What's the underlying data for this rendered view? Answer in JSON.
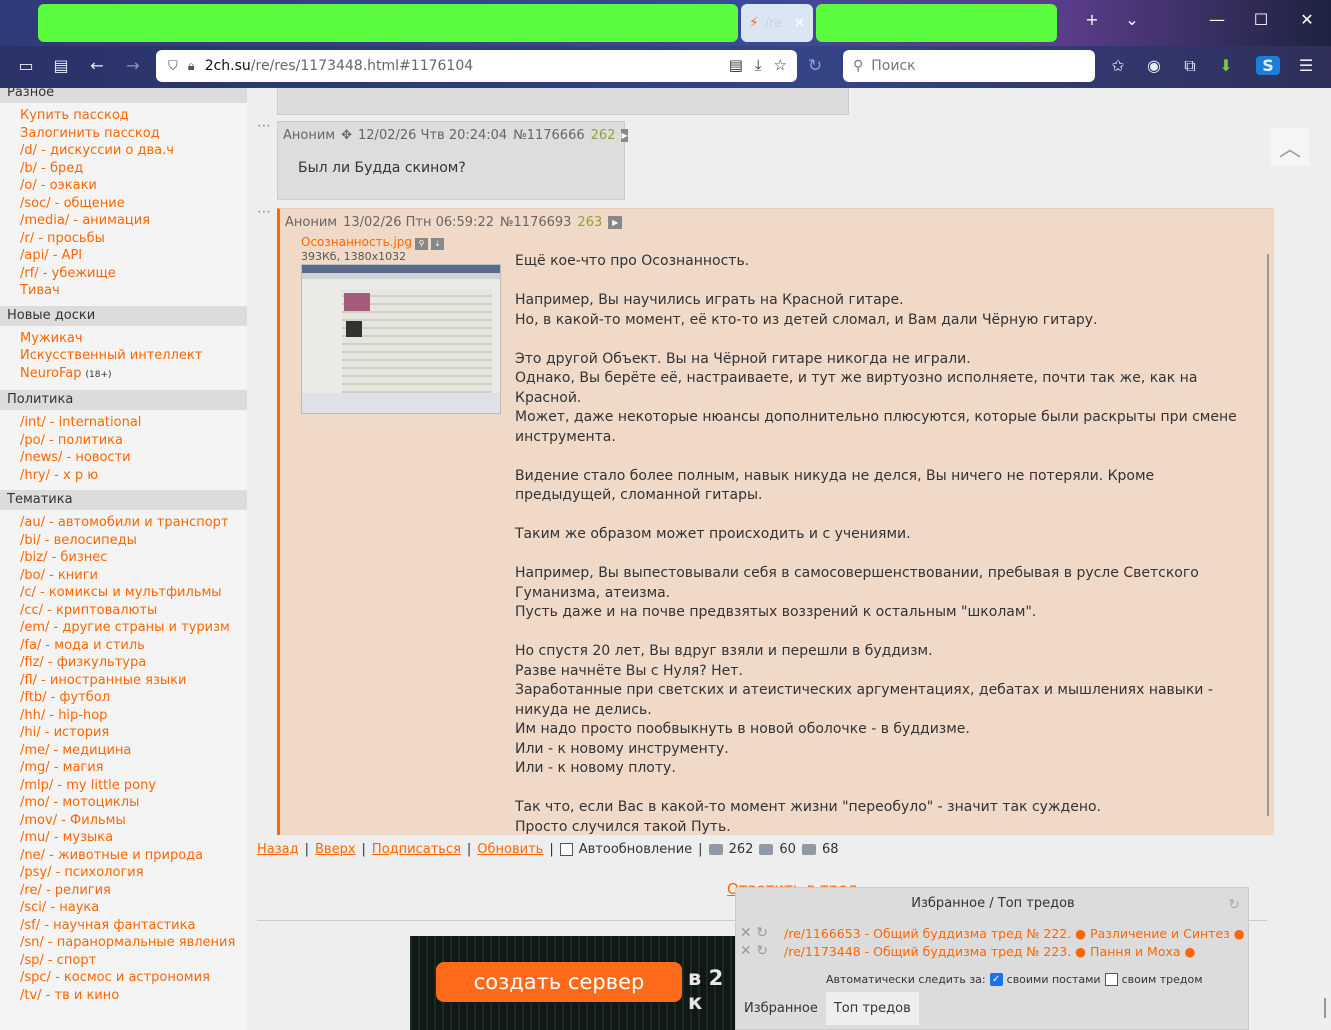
{
  "browser": {
    "tab_title": "/re",
    "url_host": "2ch.su",
    "url_path": "/re/res/1173448.html#1176104",
    "search_placeholder": "Поиск"
  },
  "sidebar": {
    "sections": [
      {
        "title": "Разное",
        "items": [
          "Купить пасскод",
          "Залогинить пасскод",
          "/d/ - дискуссии о два.ч",
          "/b/ - бред",
          "/o/ - оэкаки",
          "/soc/ - общение",
          "/media/ - анимация",
          "/r/ - просьбы",
          "/api/ - API",
          "/rf/ - убежище",
          "Тивач"
        ]
      },
      {
        "title": "Новые доски",
        "items": [
          "Мужикач",
          "Искусственный интеллект",
          "NeuroFap"
        ],
        "badge": "(18+)"
      },
      {
        "title": "Политика",
        "items": [
          "/int/ - international",
          "/po/ - политика",
          "/news/ - новости",
          "/hry/ - х р ю"
        ]
      },
      {
        "title": "Тематика",
        "items": [
          "/au/ - автомобили и транспорт",
          "/bi/ - велосипеды",
          "/biz/ - бизнес",
          "/bo/ - книги",
          "/c/ - комиксы и мультфильмы",
          "/cc/ - криптовалюты",
          "/em/ - другие страны и туризм",
          "/fa/ - мода и стиль",
          "/fiz/ - физкультура",
          "/fl/ - иностранные языки",
          "/ftb/ - футбол",
          "/hh/ - hip-hop",
          "/hi/ - история",
          "/me/ - медицина",
          "/mg/ - магия",
          "/mlp/ - my little pony",
          "/mo/ - мотоциклы",
          "/mov/ - Фильмы",
          "/mu/ - музыка",
          "/ne/ - животные и природа",
          "/psy/ - психология",
          "/re/ - религия",
          "/sci/ - наука",
          "/sf/ - научная фантастика",
          "/sn/ - паранормальные явления",
          "/sp/ - спорт",
          "/spc/ - космос и астрономия",
          "/tv/ - тв и кино"
        ]
      }
    ]
  },
  "posts": [
    {
      "author": "Аноним",
      "date": "12/02/26 Чтв 20:24:04",
      "id": "№1176666",
      "index": "262",
      "text": "Был ли Будда скином?"
    },
    {
      "author": "Аноним",
      "date": "13/02/26 Птн 06:59:22",
      "id": "№1176693",
      "index": "263",
      "file_name": "Осознанность.jpg",
      "file_meta": "393Кб, 1380x1032",
      "lines": [
        "Ещё кое-что про Осознанность.",
        "",
        "Например, Вы научились играть на Красной гитаре.",
        "Но, в какой-то момент, её кто-то из детей сломал, и Вам дали Чёрную гитару.",
        "",
        "Это другой Объект. Вы на Чёрной гитаре никогда не играли.",
        "Однако, Вы берёте её, настраиваете, и тут же виртуозно исполняете, почти так же, как на Красной.",
        "Может, даже некоторые нюансы дополнительно плюсуются, которые были раскрыты при смене инструмента.",
        "",
        "Видение стало более полным, навык никуда не делся, Вы ничего не потеряли. Кроме предыдущей, сломанной гитары.",
        "",
        "Таким же образом может происходить и с учениями.",
        "",
        "Например, Вы выпестовывали себя в самосовершенствовании, пребывая в русле Светского Гуманизма, атеизма.",
        "Пусть даже и на почве предвзятых воззрений к остальным \"школам\".",
        "",
        "Но спустя 20 лет, Вы вдруг взяли и перешли в буддизм.",
        "Разве начнёте Вы с Нуля? Нет.",
        "Заработанные при светских и атеистических аргументациях, дебатах и мышлениях навыки - никуда не делись.",
        "Им надо просто пообвыкнуть в новой оболочке - в буддизме.",
        "Или - к новому инструменту.",
        "Или - к новому плоту.",
        "",
        "Так что, если Вас в какой-то момент жизни \"переобуло\" - значит так суждено.",
        "Просто случился такой Путь."
      ]
    }
  ],
  "thread_nav": {
    "back": "Назад",
    "top": "Вверх",
    "subscribe": "Подписаться",
    "refresh": "Обновить",
    "autorefresh": "Автообновление",
    "posts_count": "262",
    "images_count": "60",
    "users_count": "68",
    "reply": "Ответить в тред"
  },
  "banner": {
    "cta": "создать сервер",
    "side_text": "в 2 к"
  },
  "favorites": {
    "header": "Избранное / Топ тредов",
    "threads": [
      "/re/1166653 - Общий буддизма тред № 222. ● Различение и Синтез ●",
      "/re/1173448 - Общий буддизма тред № 223. ● Пання и Моха ●"
    ],
    "auto_follow_label": "Автоматически следить за:",
    "opt_own_posts": "своими постами",
    "opt_own_thread": "своим тредом",
    "tab_favorites": "Избранное",
    "tab_top": "Топ тредов"
  },
  "colors": {
    "link": "#ff6600",
    "highlighted_post": "#f0d9c7",
    "post_number": "#8ba33a",
    "tab_placeholder": "#5bfb3f"
  }
}
